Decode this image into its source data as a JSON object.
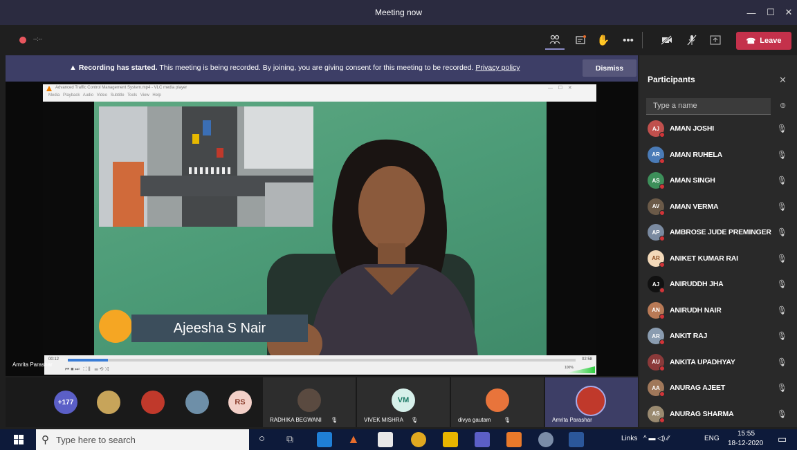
{
  "window": {
    "title": "Meeting now"
  },
  "controls": {
    "timer": "--:--",
    "leave_label": "Leave"
  },
  "banner": {
    "bold": "Recording has started.",
    "text": "This meeting is being recorded. By joining, you are giving consent for this meeting to be recorded.",
    "link": "Privacy policy",
    "dismiss_label": "Dismiss"
  },
  "vlc": {
    "title": "Advanced Traffic Control Management System.mp4 - VLC media player",
    "menu": "Media  Playback  Audio  Video  Subtitle  Tools  View  Help",
    "time_elapsed": "00:12",
    "time_total": "02:58",
    "volume": "100%"
  },
  "video": {
    "presenter_name": "Ajeesha S Nair"
  },
  "stage": {
    "speaker_caption": "Amrita Parashar"
  },
  "tiles": {
    "overflow_count": "+177",
    "rs_initials": "RS",
    "vm_initials": "VM",
    "names": [
      "RADHIKA BEGWANI",
      "VIVEK MISHRA",
      "divya gautam",
      "Amrita Parashar"
    ]
  },
  "panel": {
    "title": "Participants",
    "search_placeholder": "Type a name",
    "participants": [
      {
        "name": "AMAN JOSHI",
        "initials": "AJ",
        "color": "#c0504d"
      },
      {
        "name": "AMAN RUHELA",
        "initials": "AR",
        "color": "#4a7bb7"
      },
      {
        "name": "AMAN SINGH",
        "initials": "AS",
        "color": "#3d8f5a"
      },
      {
        "name": "AMAN VERMA",
        "initials": "AV",
        "color": "#6b5a48"
      },
      {
        "name": "AMBROSE JUDE PREMINGER",
        "initials": "AP",
        "color": "#7a8aa0"
      },
      {
        "name": "ANIKET KUMAR RAI",
        "initials": "AR",
        "color": "#f3d9b9"
      },
      {
        "name": "ANIRUDDH JHA",
        "initials": "AJ",
        "color": "#111111"
      },
      {
        "name": "ANIRUDH NAIR",
        "initials": "AN",
        "color": "#b97a56"
      },
      {
        "name": "ANKIT RAJ",
        "initials": "AR",
        "color": "#8a9cb0"
      },
      {
        "name": "ANKITA UPADHYAY",
        "initials": "AU",
        "color": "#8b3a3a"
      },
      {
        "name": "ANURAG AJEET",
        "initials": "AA",
        "color": "#a0785a"
      },
      {
        "name": "ANURAG SHARMA",
        "initials": "AS",
        "color": "#9a8a70"
      }
    ]
  },
  "taskbar": {
    "search_placeholder": "Type here to search",
    "links_label": "Links",
    "lang": "ENG",
    "time": "15:55",
    "date": "18-12-2020"
  }
}
